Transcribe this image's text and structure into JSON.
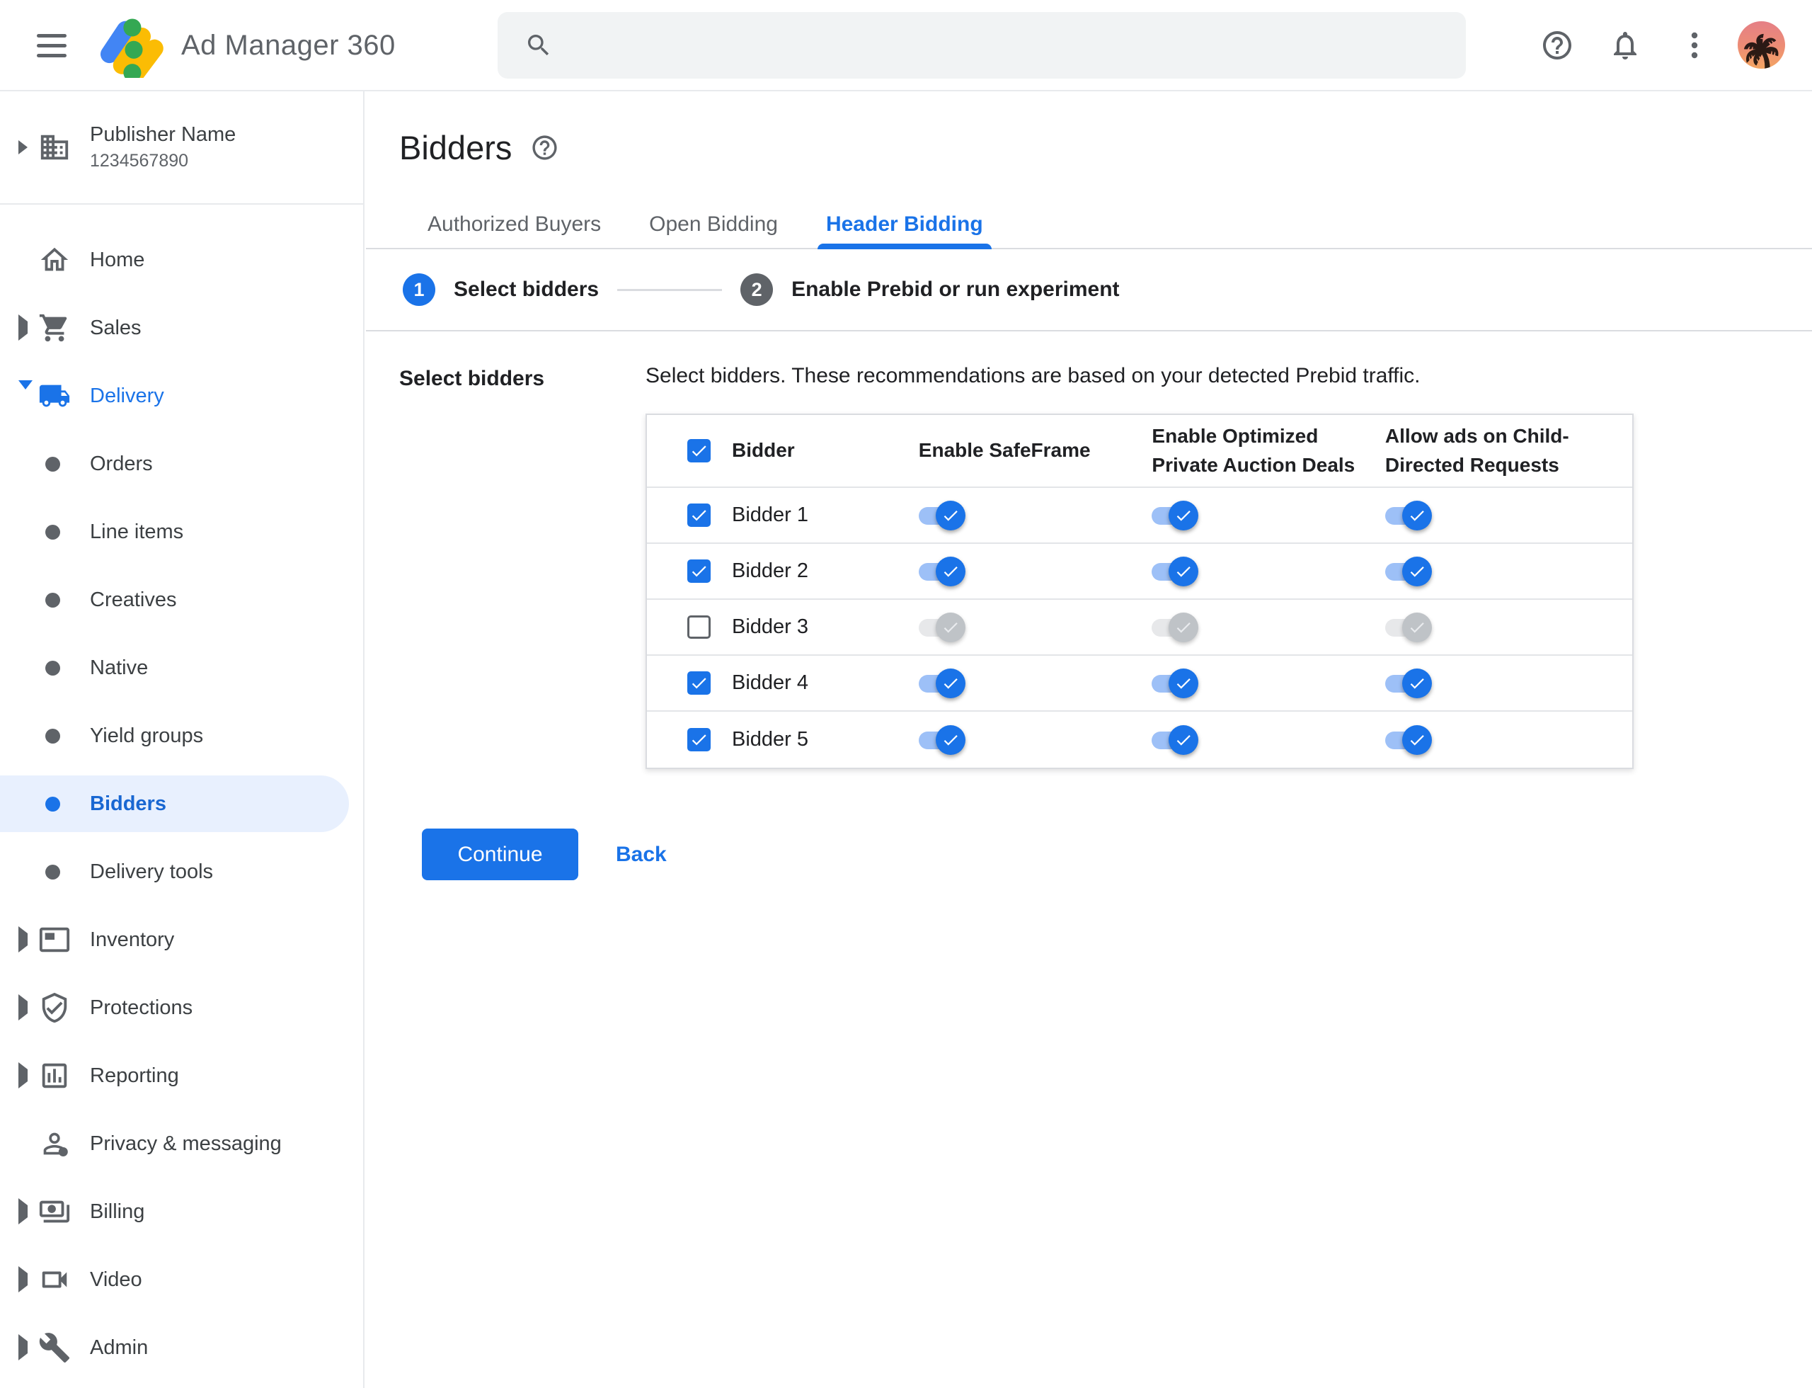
{
  "topbar": {
    "product_name": "Ad Manager 360",
    "search_placeholder": "",
    "search_value": ""
  },
  "sidebar": {
    "publisher": {
      "name": "Publisher Name",
      "id": "1234567890",
      "icon": "building-icon"
    },
    "items": [
      {
        "label": "Home",
        "icon": "home-icon",
        "arrow": "none"
      },
      {
        "label": "Sales",
        "icon": "cart-icon",
        "arrow": "right"
      },
      {
        "label": "Delivery",
        "icon": "truck-icon",
        "arrow": "down",
        "highlight": true,
        "children": [
          {
            "label": "Orders"
          },
          {
            "label": "Line items"
          },
          {
            "label": "Creatives"
          },
          {
            "label": "Native"
          },
          {
            "label": "Yield groups"
          },
          {
            "label": "Bidders",
            "selected": true
          },
          {
            "label": "Delivery tools"
          }
        ]
      },
      {
        "label": "Inventory",
        "icon": "inventory-icon",
        "arrow": "right"
      },
      {
        "label": "Protections",
        "icon": "shield-icon",
        "arrow": "right"
      },
      {
        "label": "Reporting",
        "icon": "report-icon",
        "arrow": "right"
      },
      {
        "label": "Privacy & messaging",
        "icon": "privacy-icon",
        "arrow": "none"
      },
      {
        "label": "Billing",
        "icon": "billing-icon",
        "arrow": "right"
      },
      {
        "label": "Video",
        "icon": "video-icon",
        "arrow": "right"
      },
      {
        "label": "Admin",
        "icon": "admin-icon",
        "arrow": "right"
      }
    ]
  },
  "main": {
    "title": "Bidders",
    "tabs": [
      {
        "label": "Authorized Buyers",
        "active": false
      },
      {
        "label": "Open Bidding",
        "active": false
      },
      {
        "label": "Header Bidding",
        "active": true
      }
    ],
    "stepper": [
      {
        "number": "1",
        "label": "Select bidders",
        "active": true
      },
      {
        "number": "2",
        "label": "Enable Prebid or run experiment",
        "active": false
      }
    ],
    "section_label": "Select bidders",
    "description": "Select bidders. These recommendations are based on your detected Prebid traffic.",
    "table": {
      "header_checkbox_checked": true,
      "columns": [
        "Bidder",
        "Enable SafeFrame",
        "Enable Optimized Private Auction Deals",
        "Allow ads on Child-Directed Requests"
      ],
      "toggle_names": [
        "safeframe-toggle",
        "optimized-deals-toggle",
        "child-directed-toggle"
      ],
      "rows": [
        {
          "name": "Bidder 1",
          "checked": true,
          "toggles": [
            true,
            true,
            true
          ]
        },
        {
          "name": "Bidder 2",
          "checked": true,
          "toggles": [
            true,
            true,
            true
          ]
        },
        {
          "name": "Bidder 3",
          "checked": false,
          "toggles": [
            false,
            false,
            false
          ]
        },
        {
          "name": "Bidder 4",
          "checked": true,
          "toggles": [
            true,
            true,
            true
          ]
        },
        {
          "name": "Bidder 5",
          "checked": true,
          "toggles": [
            true,
            true,
            true
          ]
        }
      ]
    },
    "actions": {
      "continue_label": "Continue",
      "back_label": "Back"
    }
  },
  "colors": {
    "accent": "#1a73e8",
    "selected_item_bg": "#e8f0fe",
    "selected_item_text": "#1967d2",
    "toggle_on_track": "#9dc0f7",
    "toggle_on_knob": "#1a73e8",
    "toggle_off_track": "#e7e8ea",
    "toggle_off_knob": "#bfc3c7",
    "step_inactive": "#5f6368",
    "text_primary": "#202124",
    "text_secondary": "#5f6368",
    "border": "#dadce0",
    "search_bg": "#f1f3f4",
    "logo_blue": "#4285f4",
    "logo_yellow": "#fbbc04",
    "logo_green": "#34a853"
  }
}
